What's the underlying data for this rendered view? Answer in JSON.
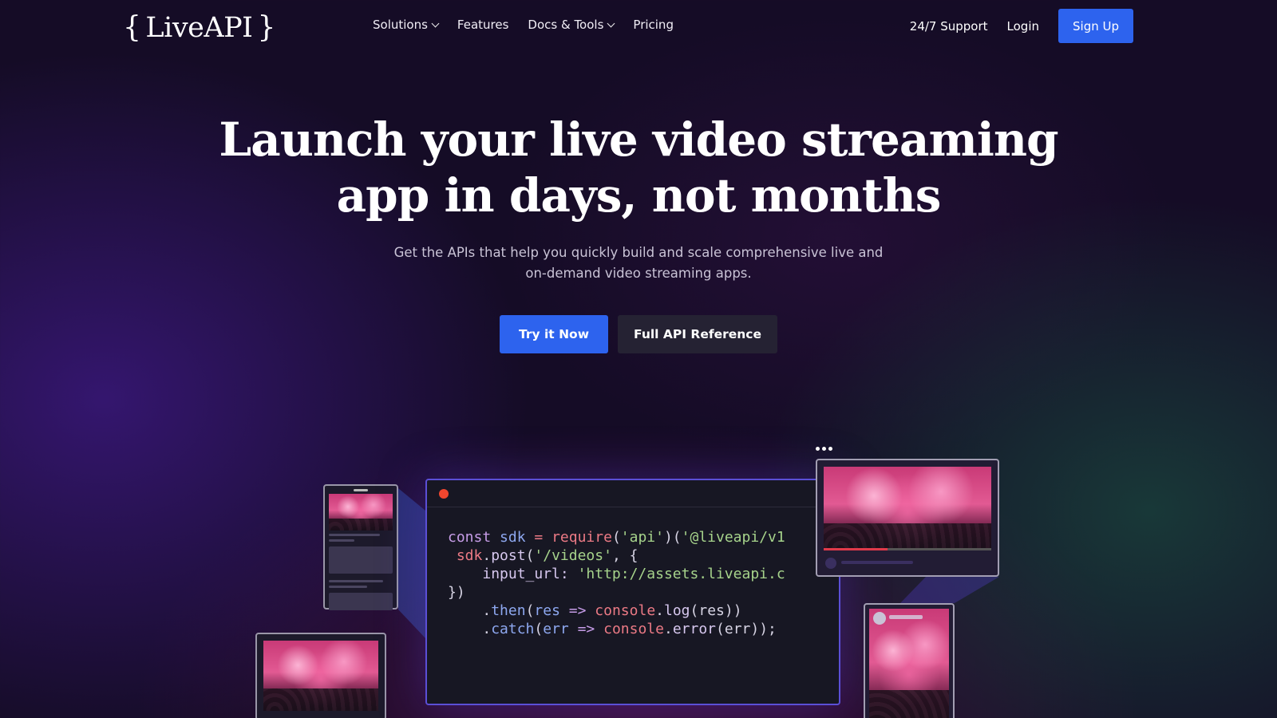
{
  "brand": {
    "name": "LiveAPI",
    "logo_text": "LiveAPI"
  },
  "nav": {
    "items": [
      {
        "label": "Solutions",
        "has_dropdown": true
      },
      {
        "label": "Features",
        "has_dropdown": false
      },
      {
        "label": "Docs & Tools",
        "has_dropdown": true
      },
      {
        "label": "Pricing",
        "has_dropdown": false
      }
    ],
    "support_label": "24/7 Support",
    "login_label": "Login",
    "signup_label": "Sign Up"
  },
  "hero": {
    "headline_line1": "Launch your live video streaming",
    "headline_line2": "app in days, not months",
    "subhead_line1": "Get the APIs that help you quickly build and scale comprehensive live and",
    "subhead_line2": "on-demand video streaming apps.",
    "primary_cta": "Try it Now",
    "secondary_cta": "Full API Reference"
  },
  "code_sample": {
    "line1": {
      "kw": "const",
      "var": "sdk",
      "op": "=",
      "fn": "require",
      "p1": "(",
      "str1": "'api'",
      "p2": ")(",
      "str2": "'@liveapi/v1"
    },
    "line2": {
      "var": "sdk",
      "dot": ".",
      "prop": "post",
      "p1": "(",
      "str": "'/videos'",
      "p2": ", {"
    },
    "line3": {
      "prop": "input_url:",
      "str": "'http://assets.liveapi.c"
    },
    "line4": {
      "text": "})"
    },
    "line5": {
      "dot": ".",
      "prop": "then",
      "p1": "(",
      "var": "res",
      "arrow": "=>",
      "fn": "console",
      "dot2": ".",
      "method": "log",
      "p2": "(res))"
    },
    "line6": {
      "dot": ".",
      "prop": "catch",
      "p1": "(",
      "var": "err",
      "arrow": "=>",
      "fn": "console",
      "dot2": ".",
      "method": "error",
      "p2": "(err));"
    }
  },
  "colors": {
    "accent": "#2d63ee",
    "record": "#f0462e",
    "code_border": "#5b4fd6"
  },
  "player": {
    "progress": 0.38
  }
}
